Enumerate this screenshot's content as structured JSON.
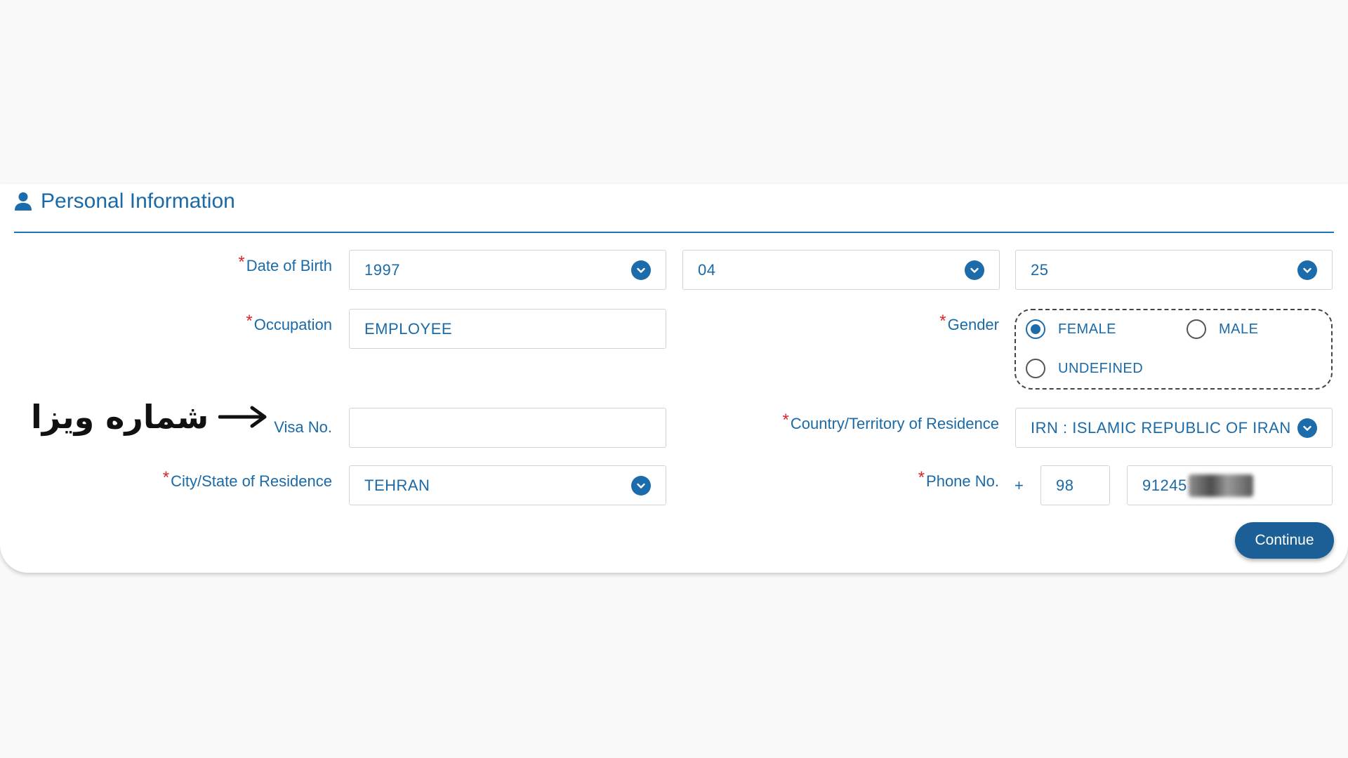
{
  "section": {
    "title": "Personal Information",
    "icon": "person-icon"
  },
  "required_mark": "*",
  "form": {
    "date_of_birth": {
      "label": "Date of Birth",
      "year": "1997",
      "month": "04",
      "day": "25"
    },
    "occupation": {
      "label": "Occupation",
      "value": "EMPLOYEE"
    },
    "gender": {
      "label": "Gender",
      "options": [
        {
          "label": "FEMALE",
          "selected": true
        },
        {
          "label": "MALE",
          "selected": false
        },
        {
          "label": "UNDEFINED",
          "selected": false
        }
      ]
    },
    "visa_no": {
      "label": "Visa No.",
      "value": ""
    },
    "country": {
      "label": "Country/Territory of Residence",
      "value": "IRN : ISLAMIC REPUBLIC OF IRAN"
    },
    "city": {
      "label": "City/State of Residence",
      "value": "TEHRAN"
    },
    "phone": {
      "label": "Phone No.",
      "plus": "+",
      "country_code": "98",
      "number": "91245"
    }
  },
  "buttons": {
    "continue": "Continue"
  },
  "annotation": {
    "text": "شماره ویزا"
  },
  "colors": {
    "accent": "#1a6aa7",
    "required": "#d9262c",
    "button": "#1b5f96"
  }
}
